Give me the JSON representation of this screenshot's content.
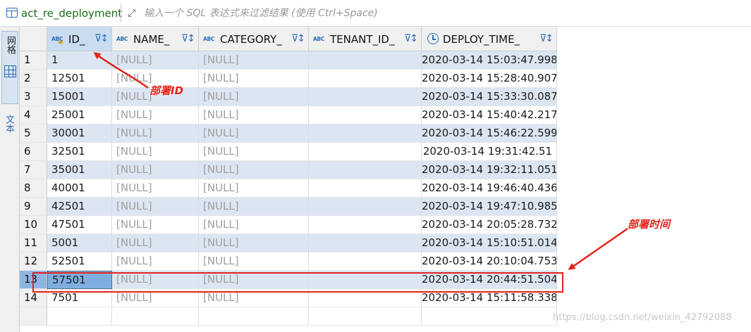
{
  "window": {
    "table_name": "act_re_deployment"
  },
  "filter": {
    "placeholder": "输入一个 SQL 表达式来过滤结果 (使用 Ctrl+Space)"
  },
  "side_tabs": {
    "grid_label": "网格",
    "text_label": "文本"
  },
  "columns": [
    {
      "name": "ID_",
      "type_icon": "abc-icon",
      "selected": true
    },
    {
      "name": "NAME_",
      "type_icon": "abc-icon"
    },
    {
      "name": "CATEGORY_",
      "type_icon": "abc-icon"
    },
    {
      "name": "TENANT_ID_",
      "type_icon": "abc-icon"
    },
    {
      "name": "DEPLOY_TIME_",
      "type_icon": "clock-icon"
    }
  ],
  "rows": [
    {
      "n": "1",
      "id": "1",
      "name": "[NULL]",
      "category": "[NULL]",
      "tenant": "",
      "deploy_time": "2020-03-14 15:03:47.998"
    },
    {
      "n": "2",
      "id": "12501",
      "name": "[NULL]",
      "category": "[NULL]",
      "tenant": "",
      "deploy_time": "2020-03-14 15:28:40.907"
    },
    {
      "n": "3",
      "id": "15001",
      "name": "[NULL]",
      "category": "[NULL]",
      "tenant": "",
      "deploy_time": "2020-03-14 15:33:30.087"
    },
    {
      "n": "4",
      "id": "25001",
      "name": "[NULL]",
      "category": "[NULL]",
      "tenant": "",
      "deploy_time": "2020-03-14 15:40:42.217"
    },
    {
      "n": "5",
      "id": "30001",
      "name": "[NULL]",
      "category": "[NULL]",
      "tenant": "",
      "deploy_time": "2020-03-14 15:46:22.599"
    },
    {
      "n": "6",
      "id": "32501",
      "name": "[NULL]",
      "category": "[NULL]",
      "tenant": "",
      "deploy_time": "2020-03-14 19:31:42.51"
    },
    {
      "n": "7",
      "id": "35001",
      "name": "[NULL]",
      "category": "[NULL]",
      "tenant": "",
      "deploy_time": "2020-03-14 19:32:11.051"
    },
    {
      "n": "8",
      "id": "40001",
      "name": "[NULL]",
      "category": "[NULL]",
      "tenant": "",
      "deploy_time": "2020-03-14 19:46:40.436"
    },
    {
      "n": "9",
      "id": "42501",
      "name": "[NULL]",
      "category": "[NULL]",
      "tenant": "",
      "deploy_time": "2020-03-14 19:47:10.985"
    },
    {
      "n": "10",
      "id": "47501",
      "name": "[NULL]",
      "category": "[NULL]",
      "tenant": "",
      "deploy_time": "2020-03-14 20:05:28.732"
    },
    {
      "n": "11",
      "id": "5001",
      "name": "[NULL]",
      "category": "[NULL]",
      "tenant": "",
      "deploy_time": "2020-03-14 15:10:51.014"
    },
    {
      "n": "12",
      "id": "52501",
      "name": "[NULL]",
      "category": "[NULL]",
      "tenant": "",
      "deploy_time": "2020-03-14 20:10:04.753"
    },
    {
      "n": "13",
      "id": "57501",
      "name": "[NULL]",
      "category": "[NULL]",
      "tenant": "",
      "deploy_time": "2020-03-14 20:44:51.504",
      "selected": true
    },
    {
      "n": "14",
      "id": "7501",
      "name": "[NULL]",
      "category": "[NULL]",
      "tenant": "",
      "deploy_time": "2020-03-14 15:11:58.338"
    }
  ],
  "annotations": {
    "id_label": "部署ID",
    "time_label": "部署时间"
  },
  "colors": {
    "annotation_red": "#e2231a",
    "selection_blue": "#7eaee0",
    "alt_row": "#dce6f2",
    "accent": "#2f6db5"
  },
  "watermark": "https://blog.csdn.net/weixin_42792088"
}
